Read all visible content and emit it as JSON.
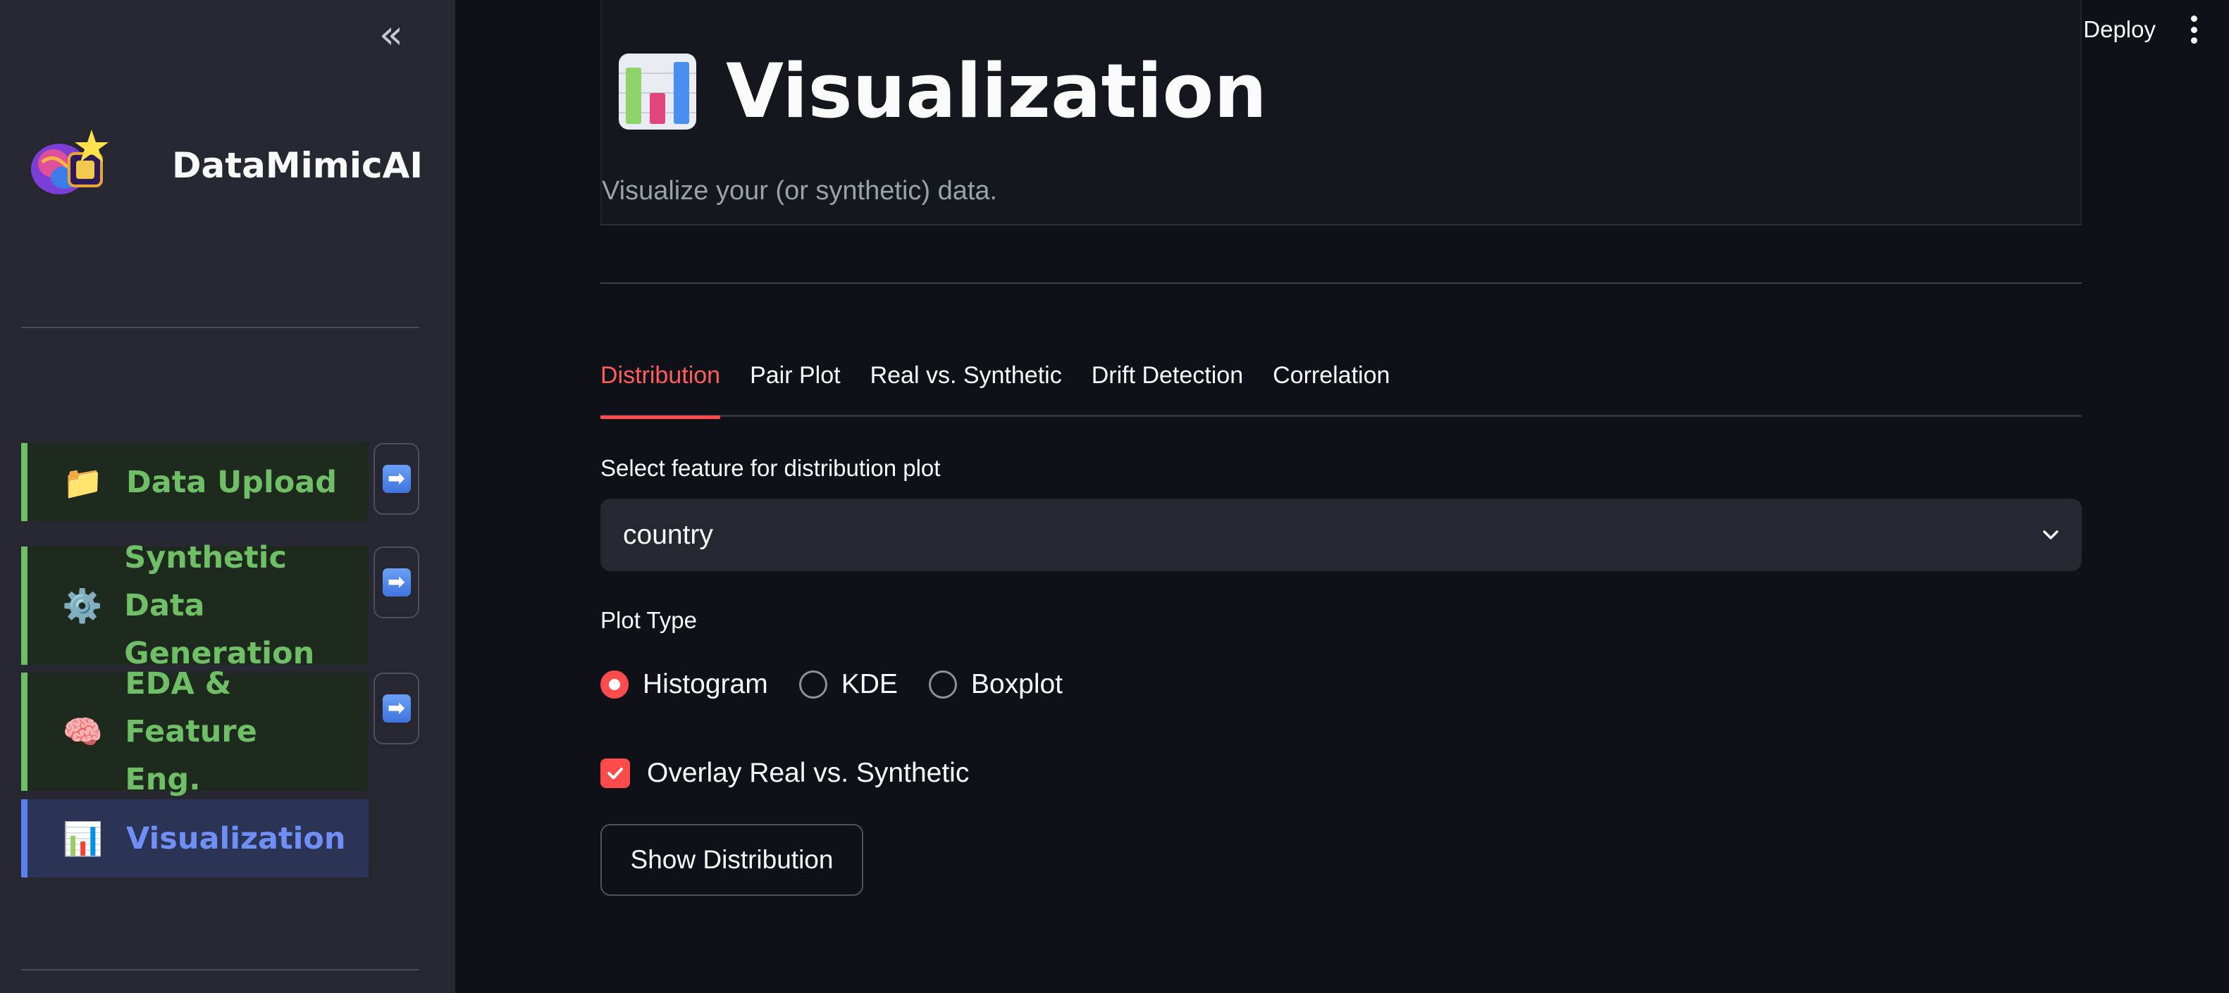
{
  "sidebar": {
    "collapse_icon": "chevrons-left-icon",
    "app_name": "DataMimicAI",
    "logo_icon": "brain-chip-logo",
    "items": [
      {
        "label": "Data Upload",
        "icon": "folder-icon",
        "glyph": "📁"
      },
      {
        "label": "Synthetic Data\nGeneration",
        "icon": "gear-icon",
        "glyph": "⚙️"
      },
      {
        "label": "EDA & Feature\nEng.",
        "icon": "brain-icon",
        "glyph": "🧠"
      },
      {
        "label": "Visualization",
        "icon": "bar-chart-icon",
        "glyph": "📊"
      }
    ],
    "arrow_glyph": "➡",
    "active_color": "#6f8ff6",
    "inactive_color": "#6fbf66"
  },
  "topbar": {
    "deploy_label": "Deploy",
    "menu_icon": "more-vertical-icon"
  },
  "header": {
    "icon": "bar-chart-icon",
    "title": "Visualization",
    "subtitle": "Visualize your (or synthetic) data."
  },
  "tabs": [
    {
      "label": "Distribution",
      "active": true
    },
    {
      "label": "Pair Plot"
    },
    {
      "label": "Real vs. Synthetic"
    },
    {
      "label": "Drift Detection"
    },
    {
      "label": "Correlation"
    }
  ],
  "feature_select": {
    "label": "Select feature for distribution plot",
    "value": "country"
  },
  "plot_type": {
    "label": "Plot Type",
    "options": [
      "Histogram",
      "KDE",
      "Boxplot"
    ],
    "selected": "Histogram"
  },
  "overlay": {
    "label": "Overlay Real vs. Synthetic",
    "checked": true
  },
  "action_button": "Show Distribution",
  "colors": {
    "accent": "#ff4b4b",
    "background": "#0e1117",
    "sidebar": "#262730"
  }
}
